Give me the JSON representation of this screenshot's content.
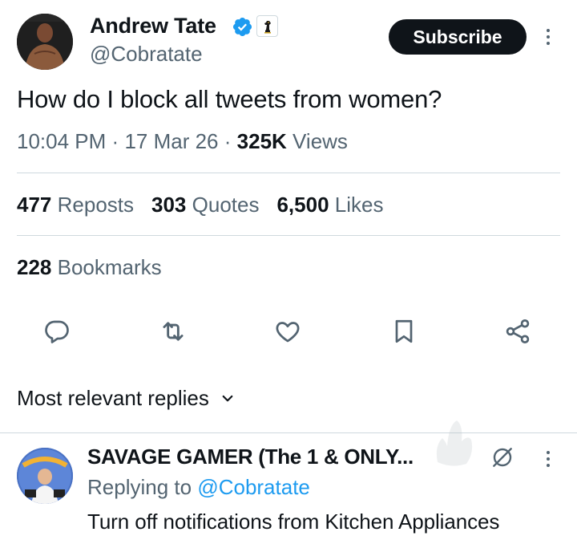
{
  "tweet": {
    "author_name": "Andrew Tate",
    "handle": "@Cobratate",
    "subscribe_label": "Subscribe",
    "text": "How do I block all tweets from women?",
    "time": "10:04 PM",
    "date": "17 Mar 26",
    "views_count": "325K",
    "views_label": "Views",
    "separator": "·",
    "verified_color": "#1d9bf0"
  },
  "stats": {
    "reposts_count": "477",
    "reposts_label": "Reposts",
    "quotes_count": "303",
    "quotes_label": "Quotes",
    "likes_count": "6,500",
    "likes_label": "Likes",
    "bookmarks_count": "228",
    "bookmarks_label": "Bookmarks"
  },
  "actions": {
    "icons": [
      "reply-icon",
      "repost-icon",
      "like-icon",
      "bookmark-icon",
      "share-icon"
    ]
  },
  "replies_sort": {
    "label": "Most relevant replies"
  },
  "reply": {
    "author_name": "SAVAGE GAMER (The 1 & ONLY...",
    "replying_prefix": "Replying to",
    "replying_handle": "@Cobratate",
    "text": "Turn off notifications from Kitchen Appliances"
  },
  "colors": {
    "text_primary": "#0f1419",
    "text_secondary": "#536471",
    "accent": "#1d9bf0",
    "divider": "#cfd9de"
  }
}
